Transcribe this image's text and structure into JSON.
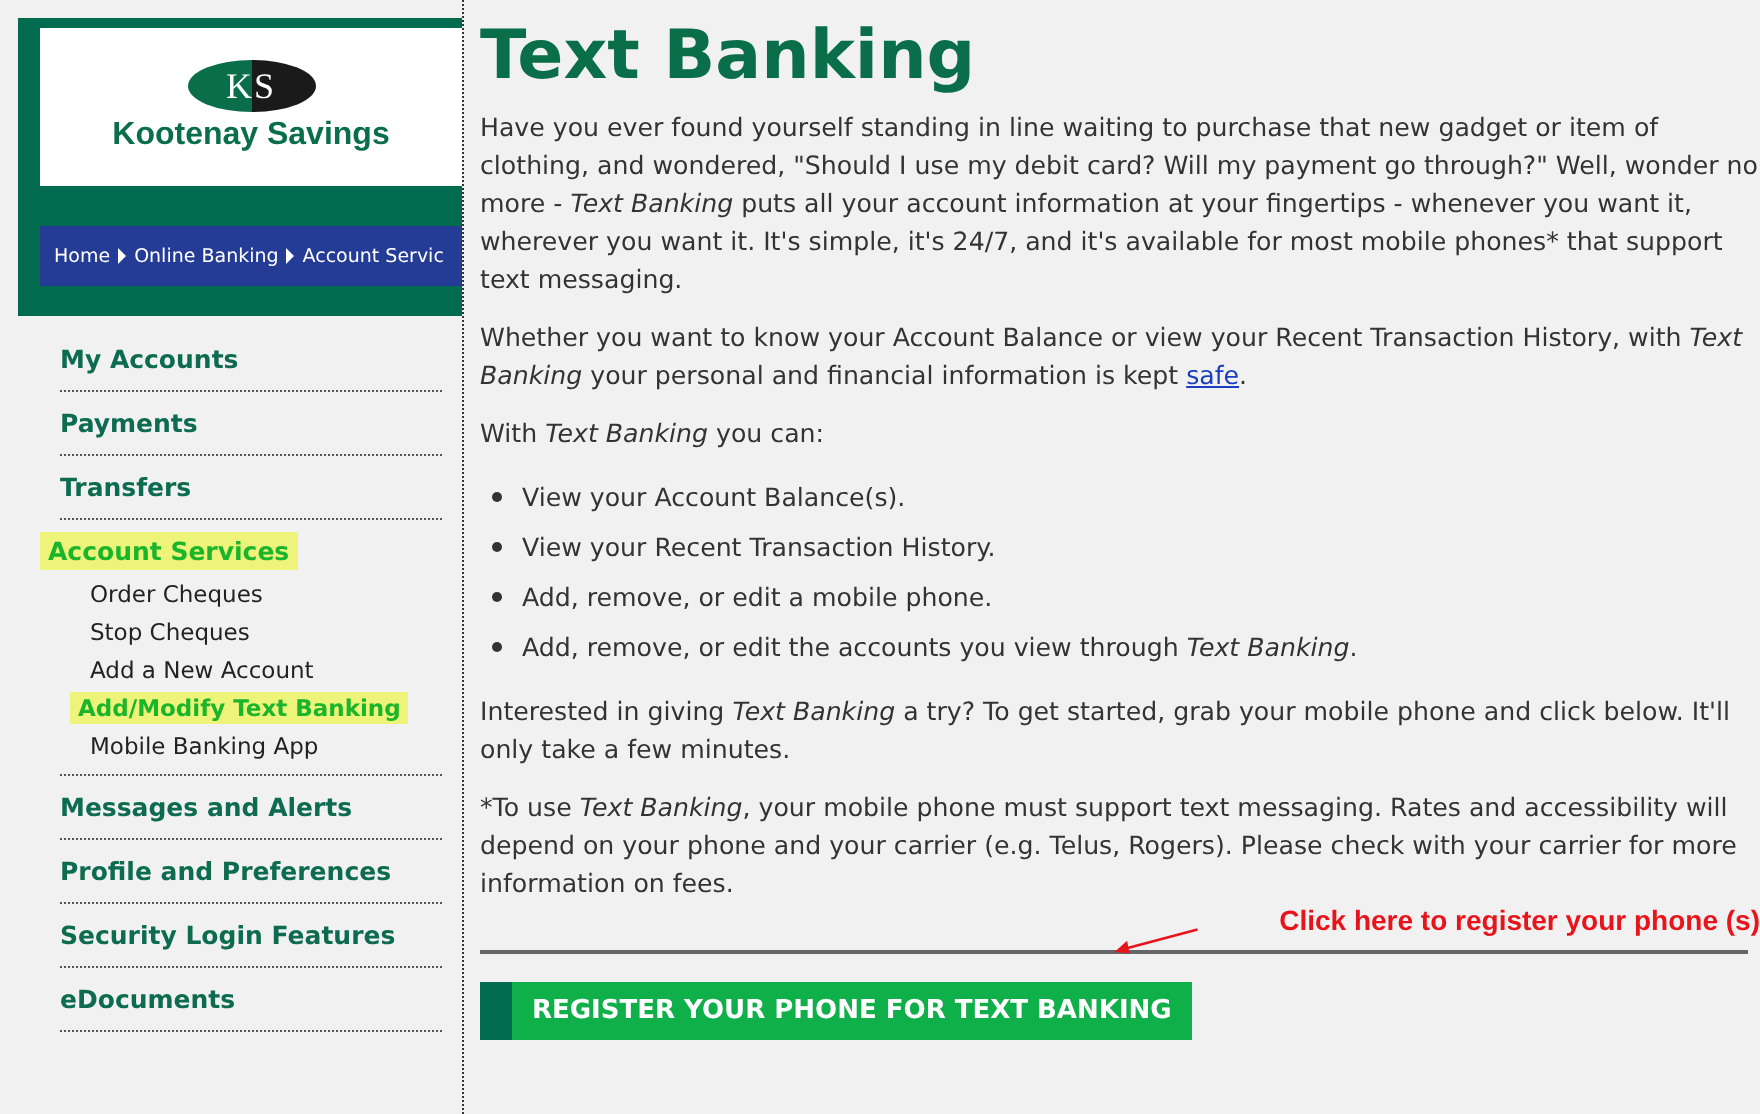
{
  "logo": {
    "monogram": "KS",
    "name": "Kootenay Savings"
  },
  "breadcrumb": [
    "Home",
    "Online Banking",
    "Account Servic"
  ],
  "sidebar": {
    "items": [
      {
        "label": "My Accounts",
        "selected": false
      },
      {
        "label": "Payments",
        "selected": false
      },
      {
        "label": "Transfers",
        "selected": false
      },
      {
        "label": "Account Services",
        "selected": true,
        "children": [
          {
            "label": "Order Cheques",
            "selected": false
          },
          {
            "label": "Stop Cheques",
            "selected": false
          },
          {
            "label": "Add a New Account",
            "selected": false
          },
          {
            "label": "Add/Modify Text Banking",
            "selected": true
          },
          {
            "label": "Mobile Banking App",
            "selected": false
          }
        ]
      },
      {
        "label": "Messages and Alerts",
        "selected": false
      },
      {
        "label": "Profile and Preferences",
        "selected": false
      },
      {
        "label": "Security Login Features",
        "selected": false
      },
      {
        "label": "eDocuments",
        "selected": false
      }
    ]
  },
  "content": {
    "title": "Text Banking",
    "intro": "Have you ever found yourself standing in line waiting to purchase that new gadget or item of clothing, and wondered, \"Should I use my debit card? Will my payment go through?\" Well, wonder no more - *Text Banking* puts all your account information at your fingertips - whenever you want it, wherever you want it. It's simple, it's 24/7, and it's available for most mobile phones* that support text messaging.",
    "safety": {
      "text": "Whether you want to know your Account Balance or view your Recent Transaction History, with *Text Banking* your personal and financial information is kept ",
      "link": "safe",
      "end": "."
    },
    "list_intro": "With *Text Banking* you can:",
    "features": [
      "View your Account Balance(s).",
      "View your Recent Transaction History.",
      "Add, remove, or edit a mobile phone.",
      "Add, remove, or edit the accounts you view through *Text Banking*."
    ],
    "try_it": "Interested in giving *Text Banking* a try? To get started, grab your mobile phone and click below. It'll only take a few minutes.",
    "footnote": "*To use *Text Banking*, your mobile phone must support text messaging. Rates and accessibility will depend on your phone and your carrier (e.g. Telus, Rogers). Please check with your carrier for more information on fees.",
    "annotation": "Click here to register your phone (s)",
    "register_button": "REGISTER YOUR PHONE FOR TEXT BANKING"
  }
}
